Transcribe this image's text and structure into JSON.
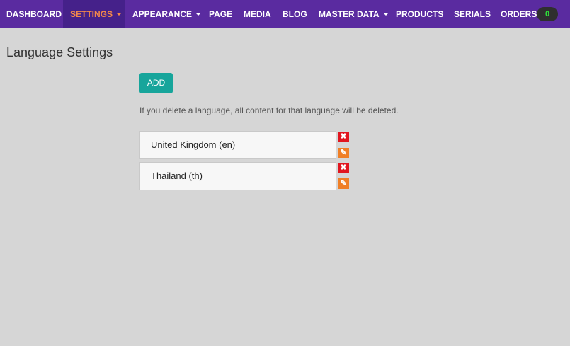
{
  "nav": {
    "items": [
      {
        "label": "DASHBOARD"
      },
      {
        "label": "SETTINGS"
      },
      {
        "label": "APPEARANCE"
      },
      {
        "label": "PAGE"
      },
      {
        "label": "MEDIA"
      },
      {
        "label": "BLOG"
      },
      {
        "label": "MASTER DATA"
      },
      {
        "label": "PRODUCTS"
      },
      {
        "label": "SERIALS"
      },
      {
        "label": "ORDERS"
      }
    ],
    "orders_count": "0"
  },
  "colors": {
    "navbar": "#5a2ba0",
    "active_tab": "#45218a",
    "active_text": "#f5894a",
    "add_button": "#17a59b",
    "delete": "#e1161f",
    "edit": "#f07f26",
    "badge_text": "#2ee03a"
  },
  "page": {
    "title": "Language Settings",
    "add_label": "ADD",
    "notice": "If you delete a language, all content for that language will be deleted."
  },
  "languages": [
    {
      "label": "United Kingdom (en)",
      "delete_icon": "close-icon",
      "edit_icon": "pencil-icon"
    },
    {
      "label": "Thailand (th)",
      "delete_icon": "close-icon",
      "edit_icon": "pencil-icon"
    }
  ]
}
